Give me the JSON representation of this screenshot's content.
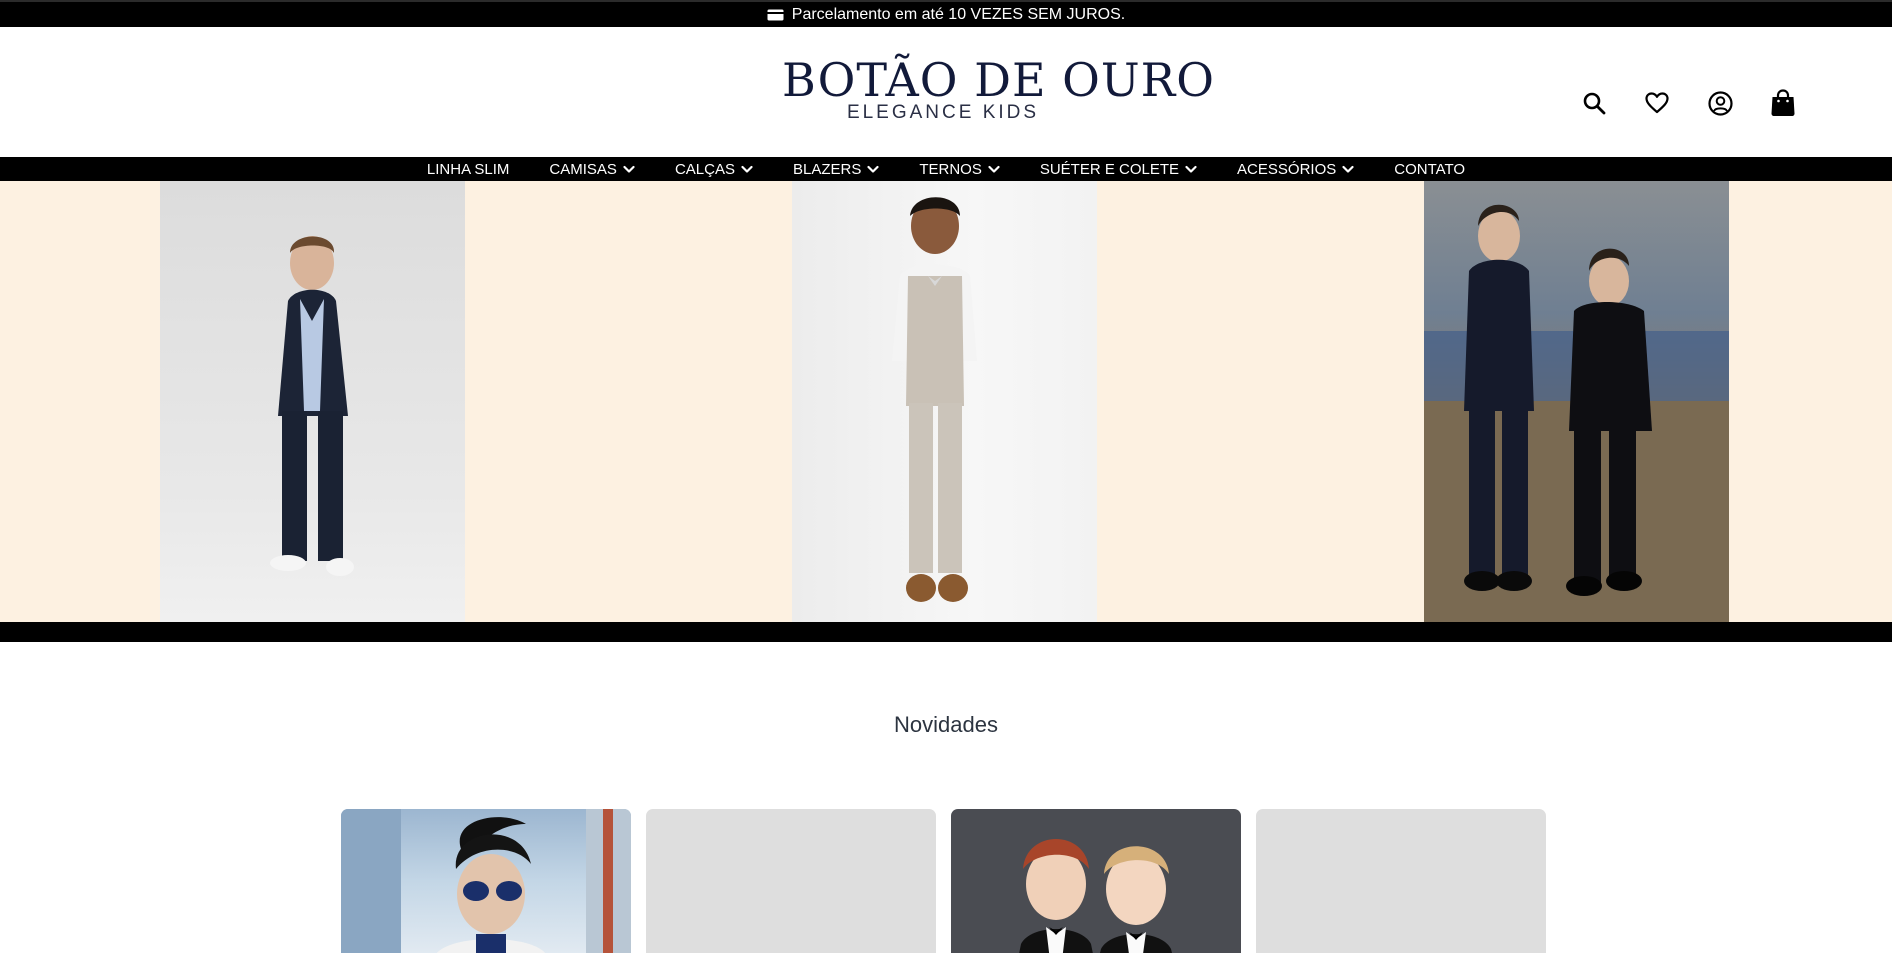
{
  "announcement": {
    "text": "Parcelamento em até 10 VEZES SEM JUROS.",
    "icon": "credit-card-icon"
  },
  "logo": {
    "main": "BOTÃO DE OURO",
    "sub": "ELEGANCE KIDS"
  },
  "header_icons": [
    "search-icon",
    "heart-icon",
    "user-icon",
    "bag-icon"
  ],
  "nav": {
    "items": [
      {
        "label": "LINHA SLIM",
        "has_dropdown": false
      },
      {
        "label": "CAMISAS",
        "has_dropdown": true
      },
      {
        "label": "CALÇAS",
        "has_dropdown": true
      },
      {
        "label": "BLAZERS",
        "has_dropdown": true
      },
      {
        "label": "TERNOS",
        "has_dropdown": true
      },
      {
        "label": "SUÉTER E COLETE",
        "has_dropdown": true
      },
      {
        "label": "ACESSÓRIOS",
        "has_dropdown": true
      },
      {
        "label": "CONTATO",
        "has_dropdown": false
      }
    ]
  },
  "hero": {
    "images": [
      "boy-navy-blazer-photo",
      "boy-grey-vest-suit-photo",
      "two-boys-tuxedo-photo"
    ]
  },
  "section": {
    "title": "Novidades"
  },
  "products": [
    "product-image-boy-sunglasses",
    "product-image-placeholder",
    "product-image-two-boys-tuxedo",
    "product-image-placeholder"
  ],
  "colors": {
    "bar": "#000000",
    "hero_bg": "#fdf1e1",
    "logo": "#121a3a"
  }
}
